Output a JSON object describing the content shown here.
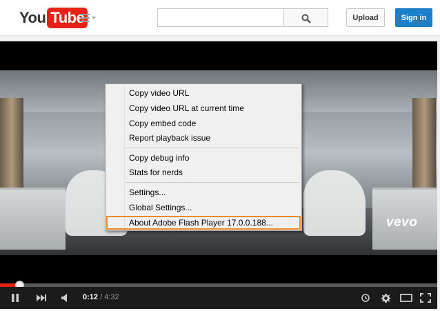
{
  "header": {
    "logo_you": "You",
    "logo_tube": "Tube",
    "search_placeholder": "",
    "upload_label": "Upload",
    "signin_label": "Sign in"
  },
  "video": {
    "watermark": "vevo"
  },
  "context_menu": {
    "items": [
      "Copy video URL",
      "Copy video URL at current time",
      "Copy embed code",
      "Report playback issue",
      "Copy debug info",
      "Stats for nerds",
      "Settings...",
      "Global Settings...",
      "About Adobe Flash Player 17.0.0.188..."
    ],
    "highlighted_item": "About Adobe Flash Player 17.0.0.188..."
  },
  "controls": {
    "current_time": "0:12",
    "separator": "/",
    "duration": "4:32",
    "progress_fraction": 0.044
  },
  "icons": {
    "guide": "hamburger-menu-icon",
    "search": "search-icon",
    "pause": "pause-icon",
    "next": "next-icon",
    "volume": "volume-icon",
    "watch_later": "clock-icon",
    "settings": "gear-icon",
    "theater": "theater-mode-icon",
    "fullscreen": "fullscreen-icon"
  },
  "colors": {
    "brand_red": "#e62117",
    "signin_blue": "#1b7fcc",
    "highlight_orange": "#e98a2c"
  }
}
